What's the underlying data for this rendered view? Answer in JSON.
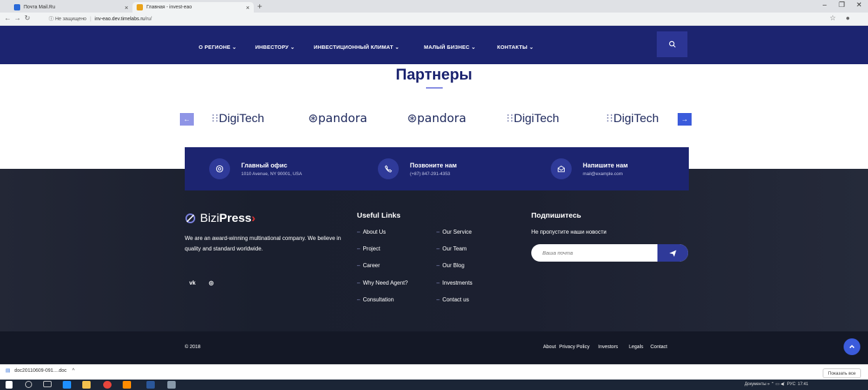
{
  "browser": {
    "tabs": [
      {
        "title": "Почта Mail.Ru",
        "active": false,
        "icon": "mail-icon"
      },
      {
        "title": "Главная - invest-eao",
        "active": true,
        "icon": "site-icon"
      }
    ],
    "new_tab": "+",
    "window_controls": [
      "–",
      "❐",
      "✕"
    ],
    "url_security": "Не защищено",
    "url_host": "inv-eao.dev.timelabs.ru",
    "url_path": "/ru/"
  },
  "nav": {
    "items": [
      "О РЕГИОНЕ",
      "ИНВЕСТОРУ",
      "ИНВЕСТИЦИОННЫЙ КЛИМАТ",
      "МАЛЫЙ БИЗНЕС",
      "КОНТАКТЫ"
    ]
  },
  "partners": {
    "title": "Партнеры",
    "logos": [
      "DigiTech",
      "pandora",
      "pandora",
      "DigiTech",
      "DigiTech"
    ],
    "prev": "←",
    "next": "→"
  },
  "contacts": [
    {
      "title": "Главный офис",
      "value": "1010 Avenue, NY 90001, USA",
      "icon": "location-icon"
    },
    {
      "title": "Позвоните нам",
      "value": "(+87) 847-291-4353",
      "icon": "phone-icon"
    },
    {
      "title": "Напишите нам",
      "value": "mail@example.com",
      "icon": "mail-icon"
    }
  ],
  "footer": {
    "brand_light": "Bizi",
    "brand_bold": "Press",
    "about": "We are an award-winning multinational company. We believe in quality and standard worldwide.",
    "social": [
      "vk",
      "instagram"
    ],
    "useful_links_title": "Useful Links",
    "links_col1": [
      "About Us",
      "Project",
      "Career",
      "Why Need Agent?",
      "Consultation"
    ],
    "links_col2": [
      "Our Service",
      "Our Team",
      "Our Blog",
      "Investments",
      "Contact us"
    ],
    "subscribe_title": "Подпишитесь",
    "subscribe_sub": "Не пропустите наши новости",
    "email_placeholder": "Ваша почта",
    "copyright": "© 2018",
    "bottom_links": [
      "About",
      "Privacy Policy",
      "Investors",
      "Legals",
      "Contact"
    ]
  },
  "download_bar": {
    "file": "doc20110609-091....doc",
    "show_all": "Показать все"
  },
  "taskbar": {
    "tray_text": "Документы",
    "lang": "РУС",
    "time": "17:41"
  },
  "colors": {
    "nav": "#1c2470",
    "accent": "#3b5bdb",
    "footer": "#1a1f2e"
  }
}
